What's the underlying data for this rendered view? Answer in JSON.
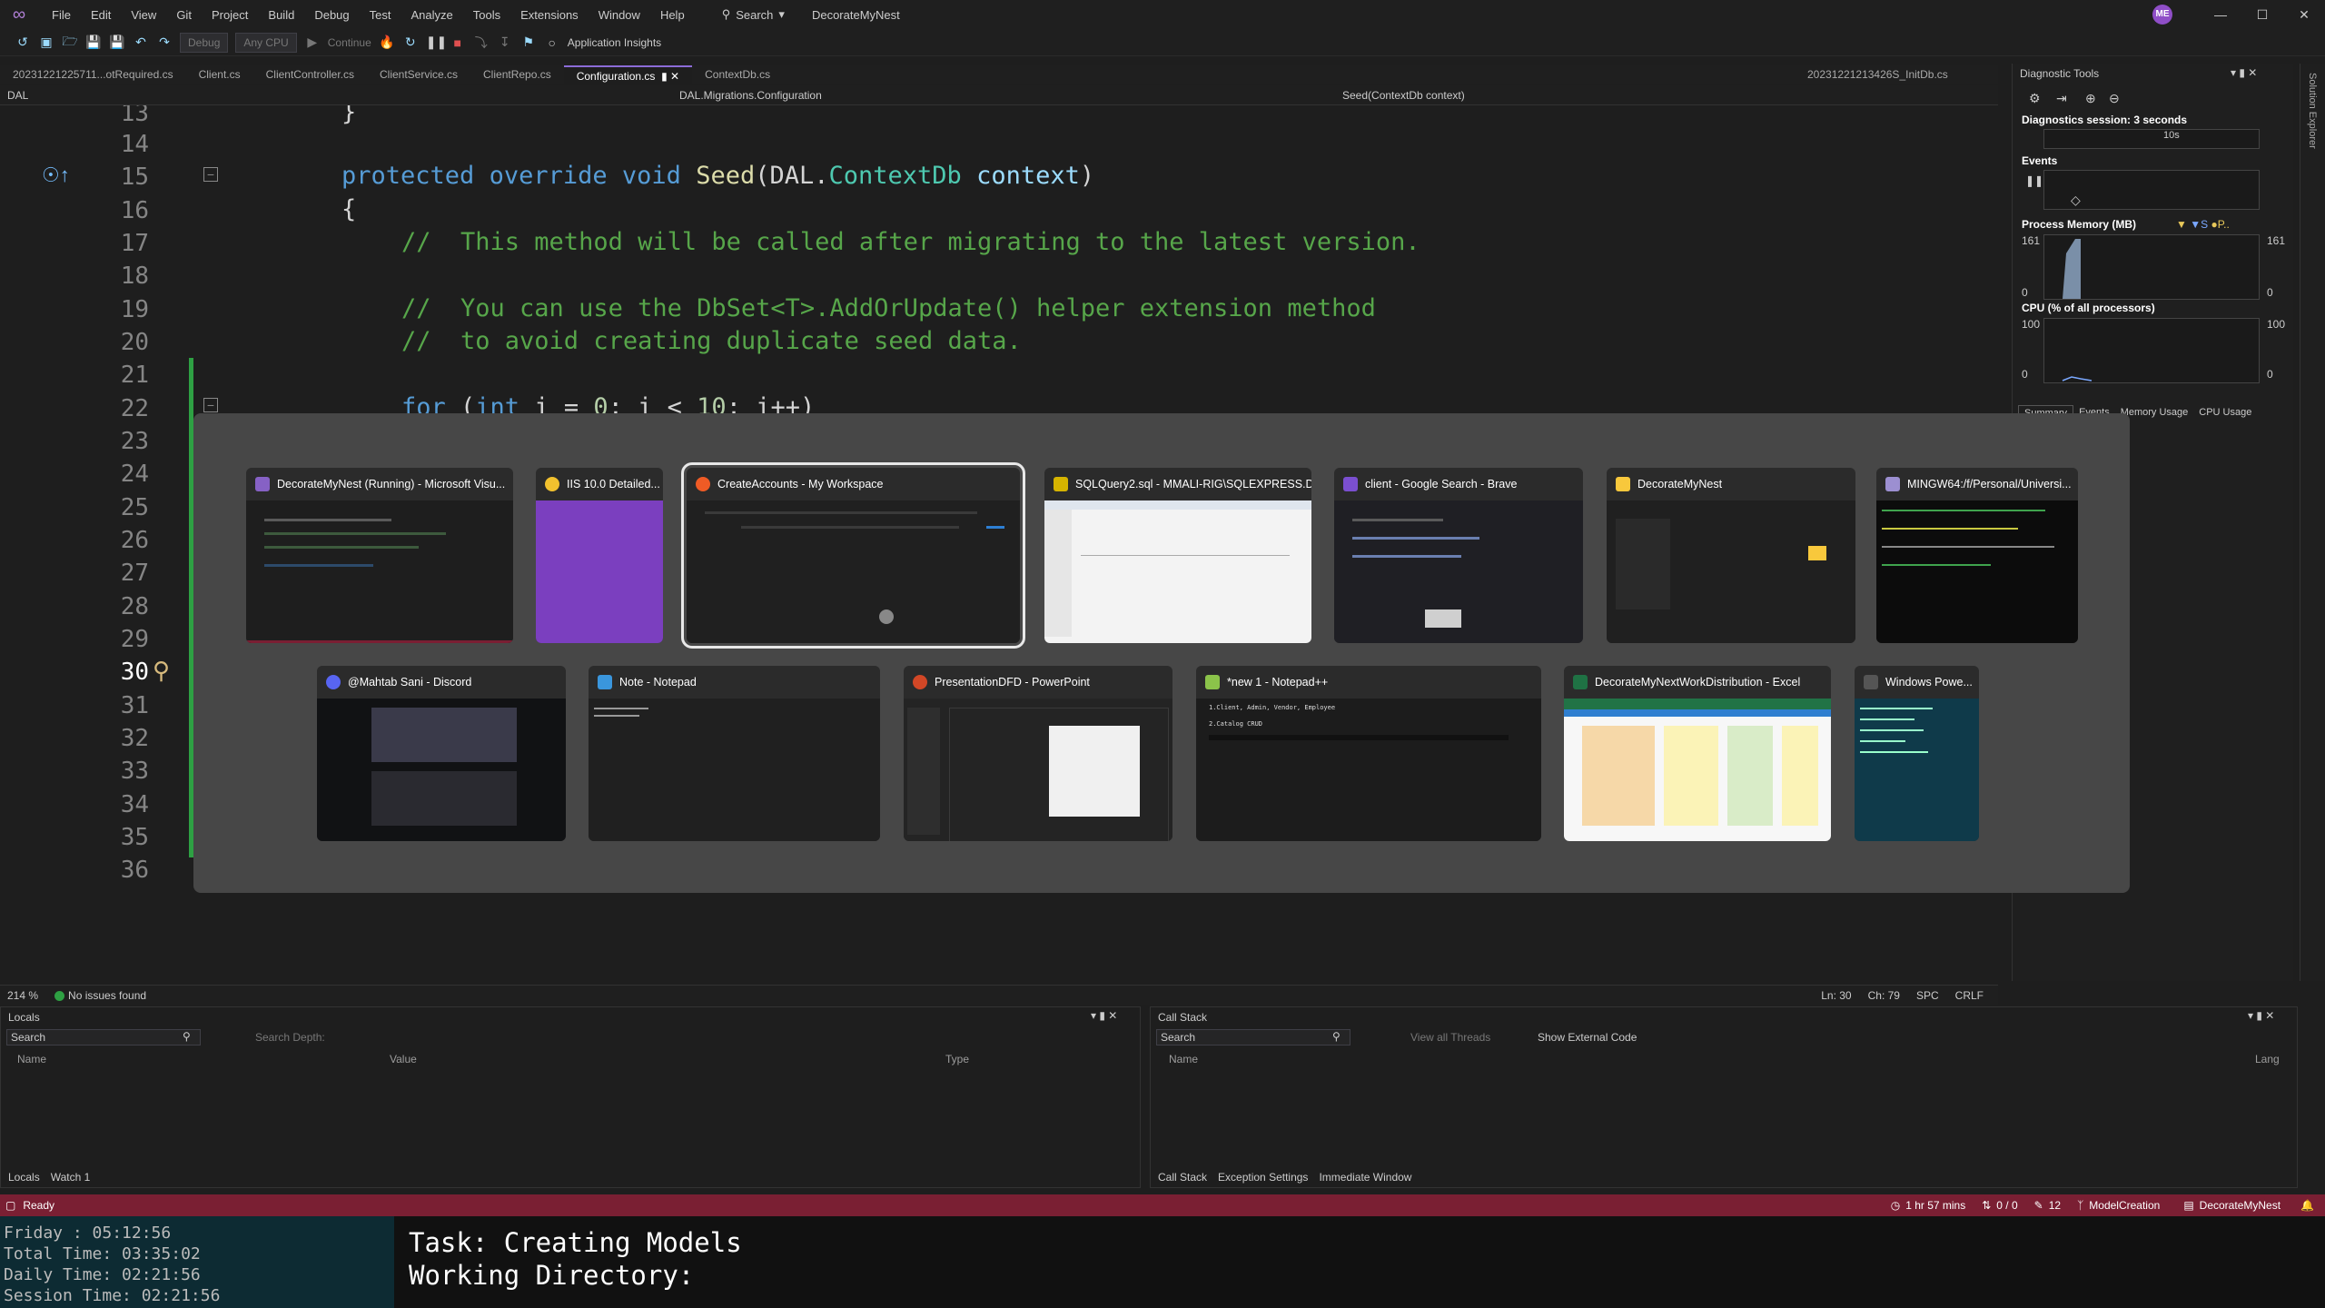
{
  "titlebar": {
    "menu": [
      "File",
      "Edit",
      "View",
      "Git",
      "Project",
      "Build",
      "Debug",
      "Test",
      "Analyze",
      "Tools",
      "Extensions",
      "Window",
      "Help"
    ],
    "search_label": "Search",
    "project_name": "DecorateMyNest",
    "avatar_initials": "ME",
    "minimize": "—",
    "maximize": "☐",
    "close": "✕"
  },
  "toolbar": {
    "config": "Debug",
    "platform": "Any CPU",
    "continue": "Continue",
    "app_insights": "Application Insights"
  },
  "tabs": [
    {
      "label": "20231221225711...otRequired.cs"
    },
    {
      "label": "Client.cs"
    },
    {
      "label": "ClientController.cs"
    },
    {
      "label": "ClientService.cs"
    },
    {
      "label": "ClientRepo.cs"
    },
    {
      "label": "Configuration.cs"
    },
    {
      "label": "ContextDb.cs"
    }
  ],
  "right_tab": "20231221213426S_InitDb.cs",
  "navbar": {
    "project": "DAL",
    "type": "DAL.Migrations.Configuration",
    "member": "Seed(ContextDb context)"
  },
  "code": {
    "lines": [
      "13",
      "14",
      "15",
      "16",
      "17",
      "18",
      "19",
      "20",
      "21",
      "22",
      "23",
      "24",
      "25",
      "26",
      "27",
      "28",
      "29",
      "30",
      "31",
      "32",
      "33",
      "34",
      "35",
      "36"
    ],
    "brace_close": "}",
    "kw_protected": "protected",
    "kw_override": "override",
    "kw_void": "void",
    "method": "Seed",
    "param_ns": "DAL.",
    "param_type": "ContextDb",
    "param_name": "context",
    "paren_close": ")",
    "brace_open": "{",
    "comment1": "//  This method will be called after migrating to the latest version.",
    "comment2": "//  You can use the DbSet<T>.AddOrUpdate() helper extension method",
    "comment3": "//  to avoid creating duplicate seed data.",
    "for_kw": "for",
    "for_open": " (",
    "for_int": "int",
    "for_init": " i = ",
    "for_zero": "0",
    "for_cond": "; i < ",
    "for_ten": "10",
    "for_end": "; i++)"
  },
  "switcher": {
    "row1": [
      {
        "title": "DecorateMyNest (Running) - Microsoft Visu...",
        "icon_color": "#8661c5",
        "icon": "visual-studio-icon"
      },
      {
        "title": "IIS 10.0 Detailed...",
        "icon_color": "#f2c12e",
        "icon": "iis-icon"
      },
      {
        "title": "CreateAccounts - My Workspace",
        "icon_color": "#ef5b25",
        "icon": "postman-icon"
      },
      {
        "title": "SQLQuery2.sql - MMALI-RIG\\SQLEXPRESS.D...",
        "icon_color": "#d6b400",
        "icon": "ssms-icon"
      },
      {
        "title": "client - Google Search - Brave",
        "icon_color": "#7b4fd0",
        "icon": "brave-icon"
      },
      {
        "title": "DecorateMyNest",
        "icon_color": "#f8c83c",
        "icon": "folder-icon"
      },
      {
        "title": "MINGW64:/f/Personal/Universi...",
        "icon_color": "#9c8fd1",
        "icon": "git-bash-icon"
      }
    ],
    "row2": [
      {
        "title": "@Mahtab Sani - Discord",
        "icon_color": "#5865f2",
        "icon": "discord-icon"
      },
      {
        "title": "Note - Notepad",
        "icon_color": "#3a96dd",
        "icon": "notepad-icon"
      },
      {
        "title": "PresentationDFD - PowerPoint",
        "icon_color": "#d24726",
        "icon": "powerpoint-icon"
      },
      {
        "title": "*new 1 - Notepad++",
        "icon_color": "#8bc34a",
        "icon": "notepadpp-icon"
      },
      {
        "title": "DecorateMyNextWorkDistribution - Excel",
        "icon_color": "#1f7244",
        "icon": "excel-icon"
      },
      {
        "title": "Windows Powe...",
        "icon_color": "#555555",
        "icon": "powershell-icon"
      }
    ],
    "notepadpp_lines": [
      "1.Client, Admin, Vendor, Employee",
      "2.Catalog CRUD"
    ]
  },
  "diag": {
    "title": "Diagnostic Tools",
    "session": "Diagnostics session: 3 seconds",
    "ruler": "10s",
    "events": "Events",
    "memory": "Process Memory (MB)",
    "mem_max": "161",
    "mem_min": "0",
    "cpu": "CPU (% of all processors)",
    "cpu_max": "100",
    "cpu_min": "0",
    "tabs": [
      "Summary",
      "Events",
      "Memory Usage",
      "CPU Usage"
    ],
    "side_label": "Solution Explorer"
  },
  "edstatus": {
    "zoom": "214 %",
    "issues": "No issues found",
    "ln": "Ln: 30",
    "ch": "Ch: 79",
    "spc": "SPC",
    "crlf": "CRLF"
  },
  "locals": {
    "title": "Locals",
    "search": "Search",
    "depth": "Search Depth:",
    "cols": [
      "Name",
      "Value",
      "Type"
    ],
    "tabs": [
      "Locals",
      "Watch 1"
    ]
  },
  "callstack": {
    "title": "Call Stack",
    "search": "Search",
    "view_threads": "View all Threads",
    "external": "Show External Code",
    "cols": [
      "Name",
      "Lang"
    ],
    "tabs": [
      "Call Stack",
      "Exception Settings",
      "Immediate Window"
    ]
  },
  "statusbar": {
    "ready": "Ready",
    "time": "1 hr 57 mins",
    "git": "0 / 0",
    "edits": "12",
    "branch": "ModelCreation",
    "repo": "DecorateMyNest"
  },
  "timer": {
    "day": "Friday  :  05:12:56",
    "total": "Total Time: 03:35:02",
    "daily": "Daily Time: 02:21:56",
    "session": "Session Time: 02:21:56"
  },
  "task": {
    "task": "Task: Creating Models",
    "dir": "Working Directory:"
  }
}
